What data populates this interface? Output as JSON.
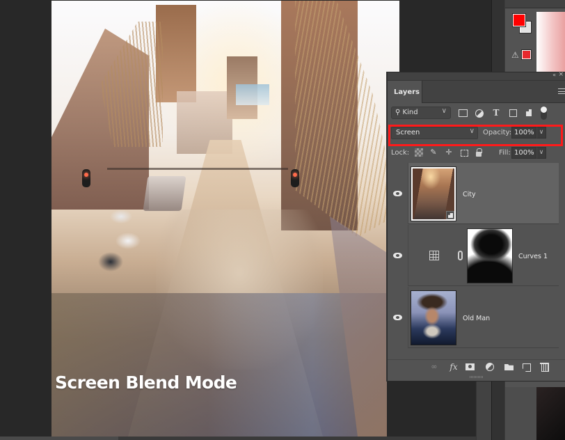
{
  "canvas": {
    "caption": "Screen Blend Mode"
  },
  "colors": {
    "foreground": "#ff0000",
    "background": "#e3e3e3",
    "gamut_warning_swatch": "#e8282e",
    "highlight_box": "#ff1a1a"
  },
  "color_panel": {
    "warning_icon": "gamut-warning-icon"
  },
  "layers_panel": {
    "tab_label": "Layers",
    "collapse_glyph": "«",
    "close_glyph": "×",
    "filter": {
      "kind_label": "Kind",
      "icons": [
        "pixel-filter-icon",
        "adjustment-filter-icon",
        "type-filter-icon",
        "shape-filter-icon",
        "smart-object-filter-icon"
      ],
      "type_glyph": "T"
    },
    "blend_mode": "Screen",
    "opacity_label": "Opacity:",
    "opacity_value": "100%",
    "lock_label": "Lock:",
    "fill_label": "Fill:",
    "fill_value": "100%",
    "chevron": "∨",
    "lock_icons": {
      "paint_glyph": "✎",
      "move_glyph": "✛"
    },
    "layers": [
      {
        "name": "City",
        "visible": true,
        "selected": true,
        "type": "smart-object"
      },
      {
        "name": "Curves 1",
        "visible": true,
        "selected": false,
        "type": "adjustment-curves"
      },
      {
        "name": "Old Man",
        "visible": true,
        "selected": false,
        "type": "pixel"
      }
    ],
    "bottom_icons": {
      "link_glyph": "∞",
      "fx_label": "fx"
    }
  }
}
